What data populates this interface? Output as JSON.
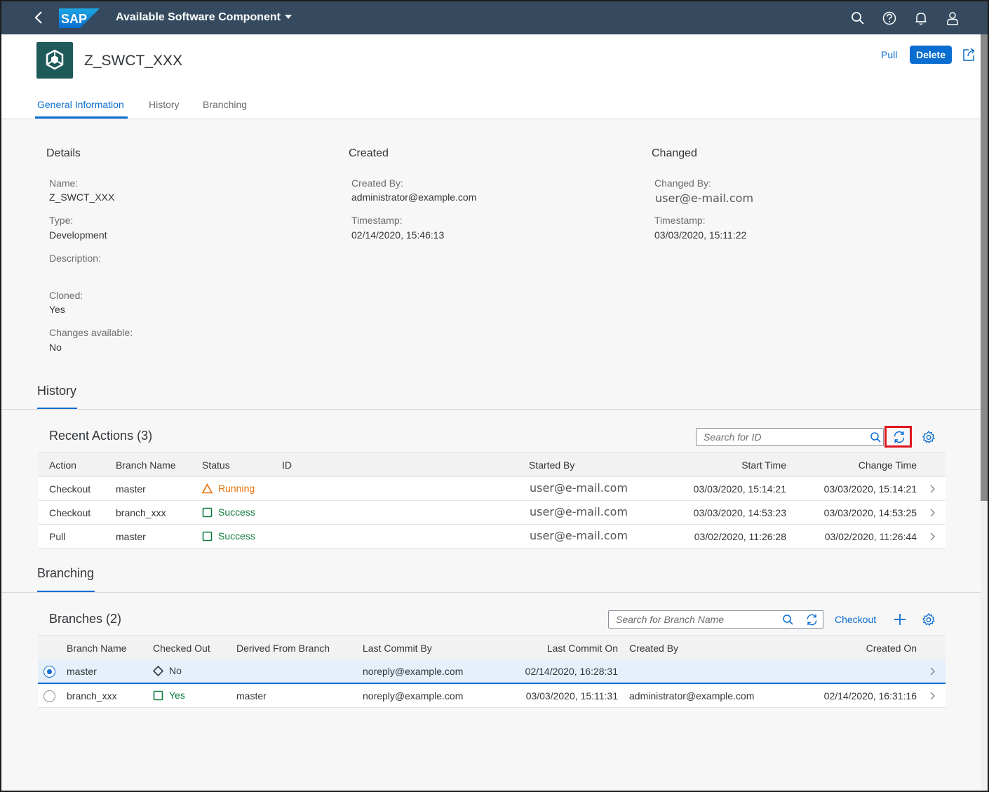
{
  "colors": {
    "shell": "#354a5f",
    "accent": "#0a6ed1",
    "warning": "#e9730c",
    "success": "#107e3e",
    "object_icon_bg": "#1e5a5a",
    "highlight": "#e0161d"
  },
  "shell": {
    "brand": "SAP",
    "title": "Available Software Component",
    "icons": [
      "back-icon",
      "search-icon",
      "help-icon",
      "notification-icon",
      "user-icon"
    ]
  },
  "object": {
    "title": "Z_SWCT_XXX",
    "icon": "software-component-icon",
    "actions": {
      "pull": "Pull",
      "delete": "Delete"
    },
    "tabs": [
      "General Information",
      "History",
      "Branching"
    ]
  },
  "general": {
    "details": {
      "heading": "Details",
      "name_label": "Name:",
      "name": "Z_SWCT_XXX",
      "type_label": "Type:",
      "type": "Development",
      "description_label": "Description:",
      "description": "",
      "cloned_label": "Cloned:",
      "cloned": "Yes",
      "changes_label": "Changes available:",
      "changes": "No"
    },
    "created": {
      "heading": "Created",
      "by_label": "Created By:",
      "by": "administrator@example.com",
      "ts_label": "Timestamp:",
      "ts": "02/14/2020, 15:46:13"
    },
    "changed": {
      "heading": "Changed",
      "by_label": "Changed By:",
      "by": "user@e-mail.com",
      "ts_label": "Timestamp:",
      "ts": "03/03/2020, 15:11:22"
    }
  },
  "history": {
    "section_title": "History",
    "table_title": "Recent Actions (3)",
    "search_placeholder": "Search for ID",
    "columns": [
      "Action",
      "Branch Name",
      "Status",
      "ID",
      "Started By",
      "Start Time",
      "Change Time"
    ],
    "rows": [
      {
        "action": "Checkout",
        "branch": "master",
        "status": "Running",
        "status_kind": "warning",
        "id": "",
        "started_by": "user@e-mail.com",
        "start": "03/03/2020, 15:14:21",
        "change": "03/03/2020, 15:14:21"
      },
      {
        "action": "Checkout",
        "branch": "branch_xxx",
        "status": "Success",
        "status_kind": "success",
        "id": "",
        "started_by": "user@e-mail.com",
        "start": "03/03/2020, 14:53:23",
        "change": "03/03/2020, 14:53:25"
      },
      {
        "action": "Pull",
        "branch": "master",
        "status": "Success",
        "status_kind": "success",
        "id": "",
        "started_by": "user@e-mail.com",
        "start": "03/02/2020, 11:26:28",
        "change": "03/02/2020, 11:26:44"
      }
    ]
  },
  "branching": {
    "section_title": "Branching",
    "table_title": "Branches (2)",
    "search_placeholder": "Search for Branch Name",
    "checkout": "Checkout",
    "columns": [
      "Branch Name",
      "Checked Out",
      "Derived From Branch",
      "Last Commit By",
      "Last Commit On",
      "Created By",
      "Created On"
    ],
    "rows": [
      {
        "selected": true,
        "name": "master",
        "checked_out": "No",
        "checked_kind": "no",
        "derived": "",
        "commit_by": "noreply@example.com",
        "commit_on": "02/14/2020, 16:28:31",
        "created_by": "",
        "created_on": ""
      },
      {
        "selected": false,
        "name": "branch_xxx",
        "checked_out": "Yes",
        "checked_kind": "yes",
        "derived": "master",
        "commit_by": "noreply@example.com",
        "commit_on": "03/03/2020, 15:11:31",
        "created_by": "administrator@example.com",
        "created_on": "02/14/2020, 16:31:16"
      }
    ]
  }
}
